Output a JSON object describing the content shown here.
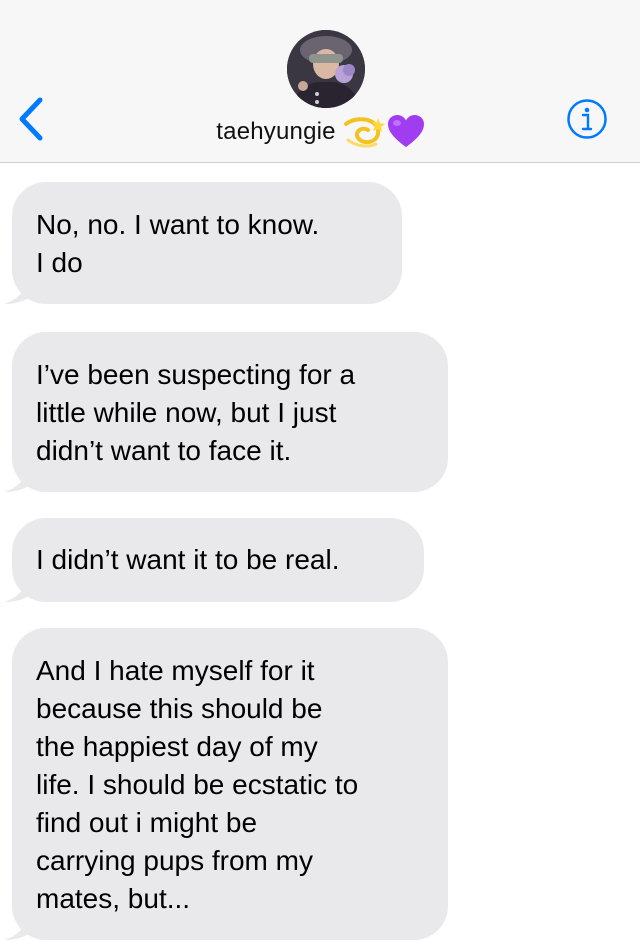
{
  "header": {
    "contact_name": "taehyungie",
    "name_emojis": [
      "dizzy-emoji",
      "purple-heart-emoji"
    ],
    "back_icon": "chevron-left-icon",
    "info_icon": "info-icon",
    "accent_color": "#007aff"
  },
  "messages": [
    {
      "text": "No, no. I want to know.\nI do"
    },
    {
      "text": "I’ve been suspecting for a\nlittle while now, but I just\ndidn’t want to face it."
    },
    {
      "text": "I didn’t want it to be real."
    },
    {
      "text": "And I hate myself for it\nbecause this should be\nthe happiest day of my\nlife. I should be ecstatic to\nfind out i might be\ncarrying pups from my\nmates, but..."
    }
  ]
}
